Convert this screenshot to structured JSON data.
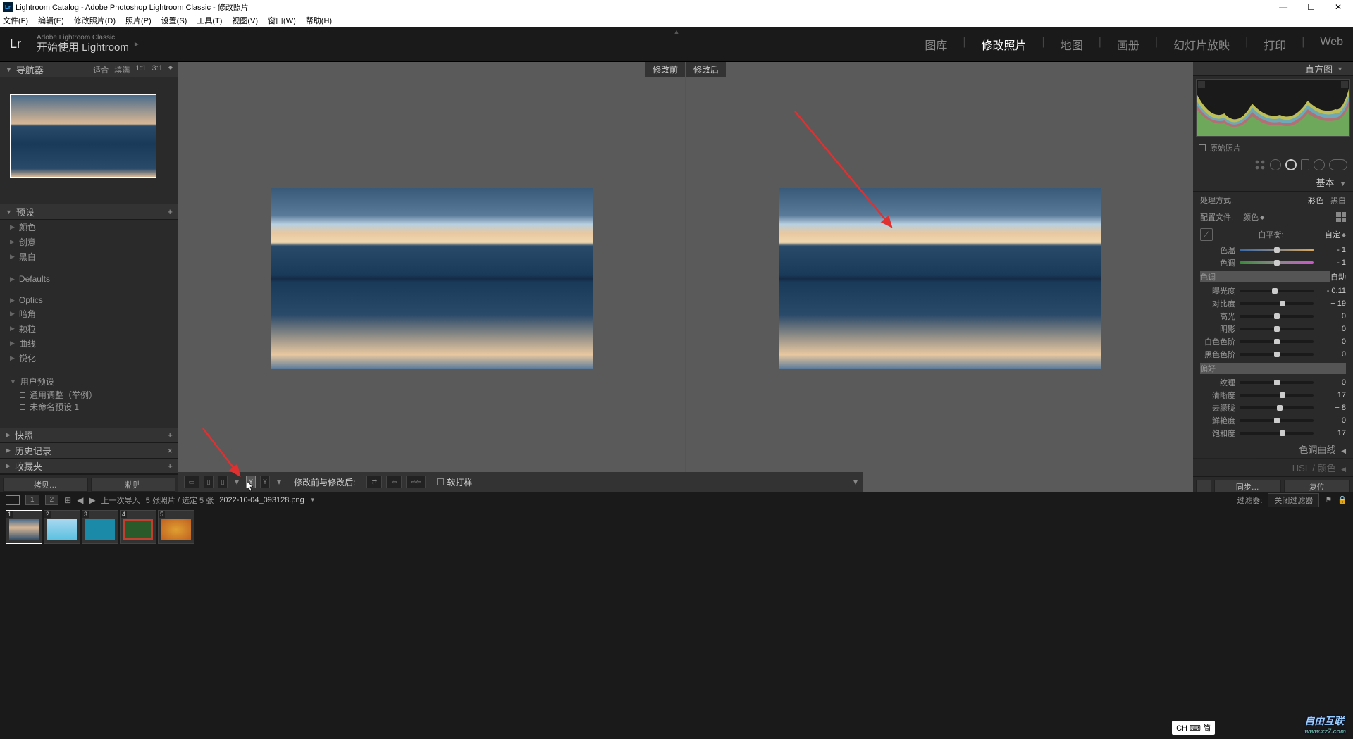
{
  "window": {
    "title": "Lightroom Catalog - Adobe Photoshop Lightroom Classic - 修改照片"
  },
  "menu": [
    "文件(F)",
    "编辑(E)",
    "修改照片(D)",
    "照片(P)",
    "设置(S)",
    "工具(T)",
    "视图(V)",
    "窗口(W)",
    "帮助(H)"
  ],
  "header": {
    "subtitle": "Adobe Lightroom Classic",
    "title": "开始使用 Lightroom"
  },
  "nav": {
    "items": [
      "图库",
      "修改照片",
      "地图",
      "画册",
      "幻灯片放映",
      "打印",
      "Web"
    ],
    "active": "修改照片"
  },
  "navigator": {
    "title": "导航器",
    "zoom": [
      "适合",
      "填满",
      "1:1",
      "3:1"
    ]
  },
  "presets": {
    "title": "预设",
    "groups": [
      "颜色",
      "创意",
      "黑白"
    ],
    "defaults": "Defaults",
    "extras": [
      "Optics",
      "暗角",
      "颗粒",
      "曲线",
      "锐化"
    ],
    "user": {
      "title": "用户预设",
      "items": [
        "通用调整（举例）",
        "未命名预设 1"
      ]
    }
  },
  "left_panels": {
    "snapshot": "快照",
    "history": "历史记录",
    "collections": "收藏夹"
  },
  "buttons": {
    "copy": "拷贝…",
    "paste": "粘贴"
  },
  "compare": {
    "before": "修改前",
    "after": "修改后"
  },
  "toolbar": {
    "label": "修改前与修改后:",
    "soft": "软打样"
  },
  "histogram": {
    "title": "直方图"
  },
  "original": "原始照片",
  "basic": {
    "title": "基本",
    "treatment": {
      "label": "处理方式:",
      "color": "彩色",
      "bw": "黑白"
    },
    "profile": {
      "label": "配置文件:",
      "value": "颜色"
    },
    "wb": {
      "label": "白平衡:",
      "value": "自定"
    },
    "temp": {
      "label": "色温",
      "value": "- 1"
    },
    "tint": {
      "label": "色调",
      "value": "- 1"
    },
    "tone": {
      "label": "色调",
      "auto": "自动"
    },
    "exposure": {
      "label": "曝光度",
      "value": "- 0.11"
    },
    "contrast": {
      "label": "对比度",
      "value": "+ 19"
    },
    "highlights": {
      "label": "高光",
      "value": "0"
    },
    "shadows": {
      "label": "阴影",
      "value": "0"
    },
    "whites": {
      "label": "白色色阶",
      "value": "0"
    },
    "blacks": {
      "label": "黑色色阶",
      "value": "0"
    },
    "presence": "偏好",
    "texture": {
      "label": "纹理",
      "value": "0"
    },
    "clarity": {
      "label": "清晰度",
      "value": "+ 17"
    },
    "dehaze": {
      "label": "去朦胧",
      "value": "+ 8"
    },
    "vibrance": {
      "label": "鲜艳度",
      "value": "0"
    },
    "saturation": {
      "label": "饱和度",
      "value": "+ 17"
    }
  },
  "tone_curve": "色调曲线",
  "hsl": "HSL / 颜色",
  "right_buttons": {
    "sync": "同步…",
    "reset": "复位"
  },
  "filmstrip": {
    "numbers": [
      "1",
      "2"
    ],
    "prev_import": "上一次导入",
    "count": "5 张照片 / 选定 5 张",
    "filename": "2022-10-04_093128.png",
    "filter_label": "过滤器:",
    "filter_value": "关闭过滤器"
  },
  "watermark": {
    "brand": "自由互联",
    "url": "www.xz7.com"
  },
  "ime": "CH ⌨ 简"
}
